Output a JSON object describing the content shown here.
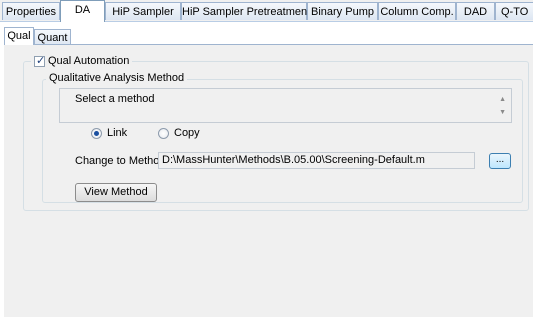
{
  "main_tabs": [
    {
      "label": "Properties",
      "active": false
    },
    {
      "label": "DA",
      "active": true
    },
    {
      "label": "HiP Sampler",
      "active": false
    },
    {
      "label": "HiP Sampler Pretreatment",
      "active": false
    },
    {
      "label": "Binary Pump",
      "active": false
    },
    {
      "label": "Column Comp.",
      "active": false
    },
    {
      "label": "DAD",
      "active": false
    },
    {
      "label": "Q-TO",
      "active": false
    }
  ],
  "sub_tabs": [
    {
      "label": "Qual",
      "active": true
    },
    {
      "label": "Quant",
      "active": false
    }
  ],
  "qual_automation": {
    "label": "Qual Automation",
    "checked": true
  },
  "method_group": {
    "title": "Qualitative Analysis Method",
    "select_text": "Select a method",
    "radio_link": "Link",
    "radio_copy": "Copy",
    "selected_option": "Link",
    "change_label": "Change to Method:",
    "method_path": "D:\\MassHunter\\Methods\\B.05.00\\Screening-Default.m",
    "browse_label": "...",
    "view_button": "View Method"
  }
}
